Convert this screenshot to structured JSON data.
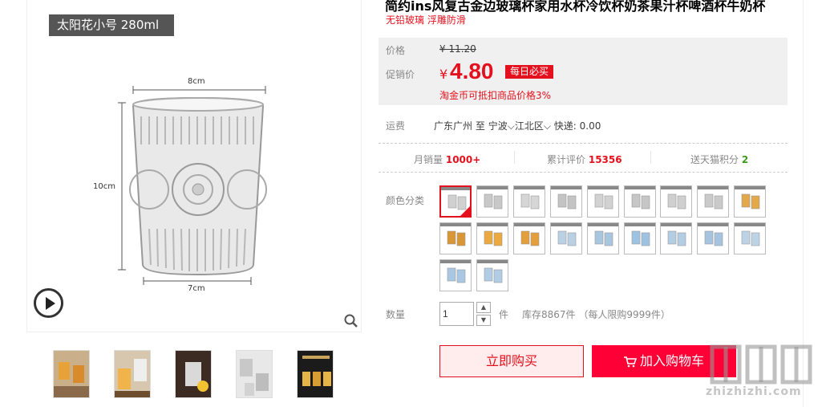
{
  "gallery": {
    "size_badge": "太阳花小号 280ml",
    "dimensions": {
      "top": "8cm",
      "height": "10cm",
      "bottom": "7cm"
    },
    "thumb_count": 5
  },
  "product": {
    "title": "简约ins风复古金边玻璃杯家用水杯冷饮杯奶茶果汁杯啤酒杯牛奶杯",
    "subtitle": "无铅玻璃 浮雕防滑"
  },
  "price": {
    "orig_label": "价格",
    "orig_value": "¥ 11.20",
    "promo_label": "促销价",
    "currency": "¥",
    "promo_value": "4.80",
    "promo_badge": "每日必买",
    "coin_note": "淘金币可抵扣商品价格3%"
  },
  "shipping": {
    "label": "运费",
    "from": "广东广州",
    "to_word": "至",
    "city": "宁波",
    "district": "江北区",
    "express": "快递: 0.00"
  },
  "stats": {
    "monthly_label": "月销量",
    "monthly_value": "1000+",
    "reviews_label": "累计评价",
    "reviews_value": "15356",
    "points_label": "送天猫积分",
    "points_value": "2"
  },
  "sku": {
    "label": "颜色分类",
    "selected_index": 0,
    "count": 20
  },
  "quantity": {
    "label": "数量",
    "value": "1",
    "unit": "件",
    "stock": "库存8867件",
    "limit": "（每人限购9999件）"
  },
  "actions": {
    "buy_now": "立即购买",
    "add_to_cart": "加入购物车"
  },
  "watermark": {
    "text": "zhizhizhi.com"
  },
  "colors": {
    "accent": "#e5101d",
    "cart": "#ff0036",
    "green": "#3c9b1c"
  }
}
